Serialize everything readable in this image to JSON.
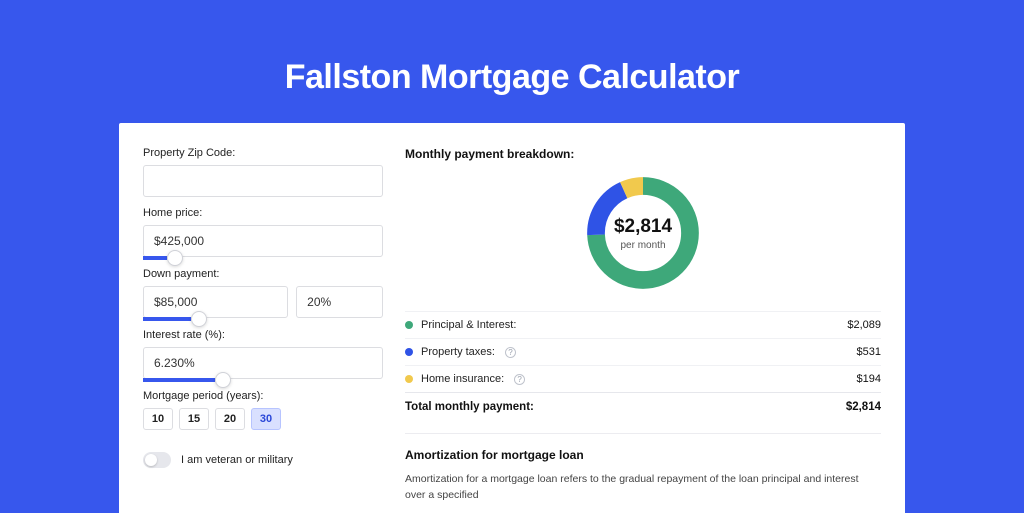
{
  "colors": {
    "accent": "#3757ed",
    "principal": "#3ea87a",
    "taxes": "#2f53e6",
    "insurance": "#f1c94d"
  },
  "page": {
    "title": "Fallston Mortgage Calculator"
  },
  "form": {
    "zip": {
      "label": "Property Zip Code:",
      "value": ""
    },
    "home_price": {
      "label": "Home price:",
      "value": "$425,000",
      "slider_pct": 10
    },
    "down_payment": {
      "label": "Down payment:",
      "amount": "$85,000",
      "percent": "20%",
      "slider_pct": 20
    },
    "interest_rate": {
      "label": "Interest rate (%):",
      "value": "6.230%",
      "slider_pct": 30
    },
    "period": {
      "label": "Mortgage period (years):",
      "options": [
        "10",
        "15",
        "20",
        "30"
      ],
      "selected": "30"
    },
    "veteran": {
      "label": "I am veteran or military",
      "checked": false
    }
  },
  "breakdown": {
    "title": "Monthly payment breakdown:",
    "center_value": "$2,814",
    "center_sub": "per month",
    "items": {
      "principal": {
        "label": "Principal & Interest:",
        "value": "$2,089"
      },
      "taxes": {
        "label": "Property taxes:",
        "value": "$531"
      },
      "insurance": {
        "label": "Home insurance:",
        "value": "$194"
      }
    },
    "total": {
      "label": "Total monthly payment:",
      "value": "$2,814"
    }
  },
  "amortization": {
    "title": "Amortization for mortgage loan",
    "body": "Amortization for a mortgage loan refers to the gradual repayment of the loan principal and interest over a specified"
  },
  "chart_data": {
    "type": "pie",
    "title": "Monthly payment breakdown",
    "categories": [
      "Principal & Interest",
      "Property taxes",
      "Home insurance"
    ],
    "values": [
      2089,
      531,
      194
    ],
    "colors": [
      "#3ea87a",
      "#2f53e6",
      "#f1c94d"
    ],
    "total": 2814,
    "center_label": "$2,814 per month"
  }
}
